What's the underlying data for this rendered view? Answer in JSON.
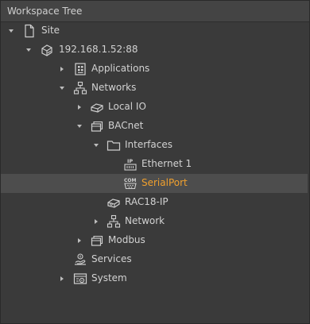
{
  "panel": {
    "title": "Workspace Tree"
  },
  "tree": {
    "site": "Site",
    "host": "192.168.1.52:88",
    "applications": "Applications",
    "networks": "Networks",
    "local_io": "Local IO",
    "bacnet": "BACnet",
    "interfaces": "Interfaces",
    "ethernet1": "Ethernet 1",
    "serialport": "SerialPort",
    "rac18ip": "RAC18-IP",
    "network": "Network",
    "modbus": "Modbus",
    "services": "Services",
    "system": "System"
  },
  "selected_item": "SerialPort",
  "icons": {
    "site": "page-icon",
    "host": "device-icon",
    "applications": "applications-icon",
    "networks": "network-icon",
    "local_io": "io-module-icon",
    "bacnet": "stack-icon",
    "interfaces": "folder-icon",
    "ethernet1": "ip-port-icon",
    "serialport": "com-port-icon",
    "rac18ip": "controller-icon",
    "network": "network-icon",
    "modbus": "stack-icon",
    "services": "services-icon",
    "system": "system-icon"
  },
  "colors": {
    "background": "#3a3a3a",
    "header": "#444444",
    "text": "#d2d2d2",
    "selected_text": "#f0a02e",
    "selected_bg": "#4d4d4d"
  }
}
